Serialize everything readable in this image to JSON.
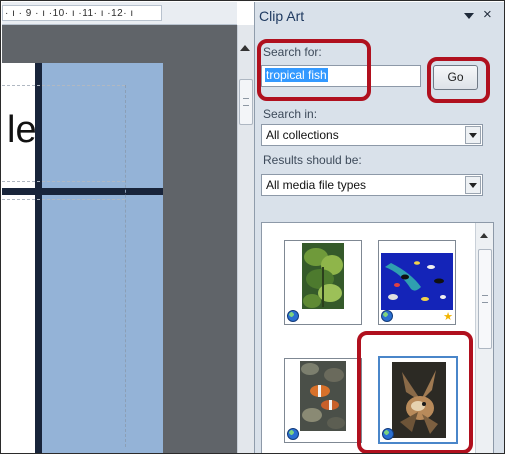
{
  "ruler": {
    "text": "· ı · 9 · ı ·10· ı ·11· ı ·12· ı"
  },
  "document": {
    "title_fragment": "le"
  },
  "pane": {
    "title": "Clip Art",
    "menu_icon": "dropdown-arrow-icon",
    "close_icon": "×",
    "search_label": "Search for:",
    "search_value": "tropical fish",
    "go_label": "Go",
    "search_in_label": "Search in:",
    "search_in_value": "All collections",
    "results_label": "Results should be:",
    "results_value": "All media file types"
  },
  "results": [
    {
      "name": "clip-result-1",
      "badge": "globe-icon",
      "selected": false
    },
    {
      "name": "clip-result-2",
      "badge": "globe-icon",
      "extra_badge": "star-icon",
      "selected": false
    },
    {
      "name": "clip-result-3",
      "badge": "globe-icon",
      "selected": false
    },
    {
      "name": "clip-result-4",
      "badge": "globe-icon",
      "selected": true
    }
  ],
  "annotations": {
    "highlight_color": "#b0101e"
  }
}
